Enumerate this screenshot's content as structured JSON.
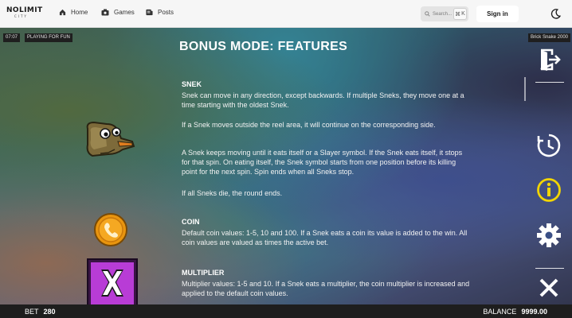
{
  "topbar": {
    "logo_main": "NOLIMIT",
    "logo_sub": "CITY",
    "nav": {
      "home": "Home",
      "games": "Games",
      "posts": "Posts"
    },
    "search_placeholder": "Search...",
    "search_shortcut_key": "K",
    "signin_label": "Sign in"
  },
  "hud": {
    "clock": "07:07",
    "mode": "PLAYING FOR FUN",
    "game_name": "Brick Snake 2000"
  },
  "rules": {
    "heading": "BONUS MODE: FEATURES",
    "snek": {
      "title": "SNEK",
      "p1": "Snek can move in any direction, except backwards. If multiple Sneks, they move one at a time starting with the oldest Snek.",
      "p2": "If a Snek moves outside the reel area, it will continue on the corresponding side.",
      "p3": "A Snek keeps moving until it eats itself or a Slayer symbol. If the Snek eats itself, it stops for that spin. On eating itself, the Snek symbol starts from one position before its killing point for the next spin. Spin ends when all Sneks stop.",
      "p4": "If all Sneks die, the round ends."
    },
    "coin": {
      "title": "COIN",
      "p1": "Default coin values: 1-5, 10 and 100. If a Snek eats a coin its value is added to the win. All coin values are valued as times the active bet."
    },
    "multiplier": {
      "title": "MULTIPLIER",
      "p1": "Multiplier values: 1-5 and 10. If a Snek eats a multiplier, the coin multiplier is increased and applied to the default coin values."
    }
  },
  "sidebar": {
    "icons": [
      "exit-icon",
      "history-icon",
      "info-icon",
      "settings-icon",
      "close-icon"
    ]
  },
  "footer": {
    "bet_label": "BET",
    "bet_value": "280",
    "balance_label": "BALANCE",
    "balance_value": "9999.00"
  },
  "colors": {
    "info_accent": "#f2d500",
    "topbar_bg": "#f6f6f6",
    "bottombar_bg": "#1e1e1e",
    "multiplier_bg": "#b83cd6"
  }
}
